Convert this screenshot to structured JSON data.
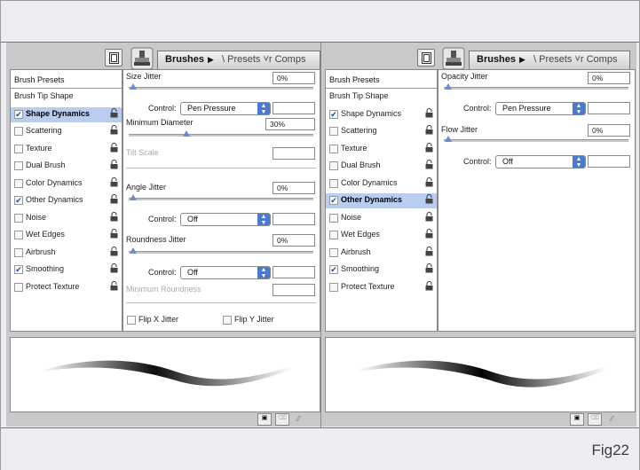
{
  "figure_label": "Fig22",
  "left_panel": {
    "tab_active": "Brushes",
    "tab_arrow": "▶",
    "tab_inactive": "\\ Presets ˅r Comps",
    "sidebar_header": "Brush Presets",
    "items": [
      {
        "label": "Brush Tip Shape",
        "checkbox": false,
        "checked": false,
        "selected": false
      },
      {
        "label": "Shape Dynamics",
        "checkbox": true,
        "checked": true,
        "selected": true
      },
      {
        "label": "Scattering",
        "checkbox": true,
        "checked": false,
        "selected": false
      },
      {
        "label": "Texture",
        "checkbox": true,
        "checked": false,
        "selected": false
      },
      {
        "label": "Dual Brush",
        "checkbox": true,
        "checked": false,
        "selected": false
      },
      {
        "label": "Color Dynamics",
        "checkbox": true,
        "checked": false,
        "selected": false
      },
      {
        "label": "Other Dynamics",
        "checkbox": true,
        "checked": true,
        "selected": false
      },
      {
        "label": "Noise",
        "checkbox": true,
        "checked": false,
        "selected": false
      },
      {
        "label": "Wet Edges",
        "checkbox": true,
        "checked": false,
        "selected": false
      },
      {
        "label": "Airbrush",
        "checkbox": true,
        "checked": false,
        "selected": false
      },
      {
        "label": "Smoothing",
        "checkbox": true,
        "checked": true,
        "selected": false
      },
      {
        "label": "Protect Texture",
        "checkbox": true,
        "checked": false,
        "selected": false
      }
    ],
    "size_jitter_label": "Size Jitter",
    "size_jitter_value": "0%",
    "control_label": "Control:",
    "size_control": "Pen Pressure",
    "min_diameter_label": "Minimum Diameter",
    "min_diameter_value": "30%",
    "tilt_scale_label": "Tilt Scale",
    "angle_jitter_label": "Angle Jitter",
    "angle_jitter_value": "0%",
    "angle_control": "Off",
    "roundness_jitter_label": "Roundness Jitter",
    "roundness_jitter_value": "0%",
    "roundness_control": "Off",
    "min_roundness_label": "Minimum Roundness",
    "flip_x_label": "Flip X Jitter",
    "flip_y_label": "Flip Y Jitter"
  },
  "right_panel": {
    "tab_active": "Brushes",
    "tab_arrow": "▶",
    "tab_inactive": "\\ Presets ˅r Comps",
    "sidebar_header": "Brush Presets",
    "items": [
      {
        "label": "Brush Tip Shape",
        "checkbox": false,
        "checked": false,
        "selected": false
      },
      {
        "label": "Shape Dynamics",
        "checkbox": true,
        "checked": true,
        "selected": false
      },
      {
        "label": "Scattering",
        "checkbox": true,
        "checked": false,
        "selected": false
      },
      {
        "label": "Texture",
        "checkbox": true,
        "checked": false,
        "selected": false
      },
      {
        "label": "Dual Brush",
        "checkbox": true,
        "checked": false,
        "selected": false
      },
      {
        "label": "Color Dynamics",
        "checkbox": true,
        "checked": false,
        "selected": false
      },
      {
        "label": "Other Dynamics",
        "checkbox": true,
        "checked": true,
        "selected": true
      },
      {
        "label": "Noise",
        "checkbox": true,
        "checked": false,
        "selected": false
      },
      {
        "label": "Wet Edges",
        "checkbox": true,
        "checked": false,
        "selected": false
      },
      {
        "label": "Airbrush",
        "checkbox": true,
        "checked": false,
        "selected": false
      },
      {
        "label": "Smoothing",
        "checkbox": true,
        "checked": true,
        "selected": false
      },
      {
        "label": "Protect Texture",
        "checkbox": true,
        "checked": false,
        "selected": false
      }
    ],
    "opacity_jitter_label": "Opacity Jitter",
    "opacity_jitter_value": "0%",
    "control_label": "Control:",
    "opacity_control": "Pen Pressure",
    "flow_jitter_label": "Flow Jitter",
    "flow_jitter_value": "0%",
    "flow_control": "Off"
  },
  "colors": {
    "selection": "#b8cdf0",
    "slider_knob": "#6a8bd6",
    "select_arrow": "#4a79d0"
  }
}
